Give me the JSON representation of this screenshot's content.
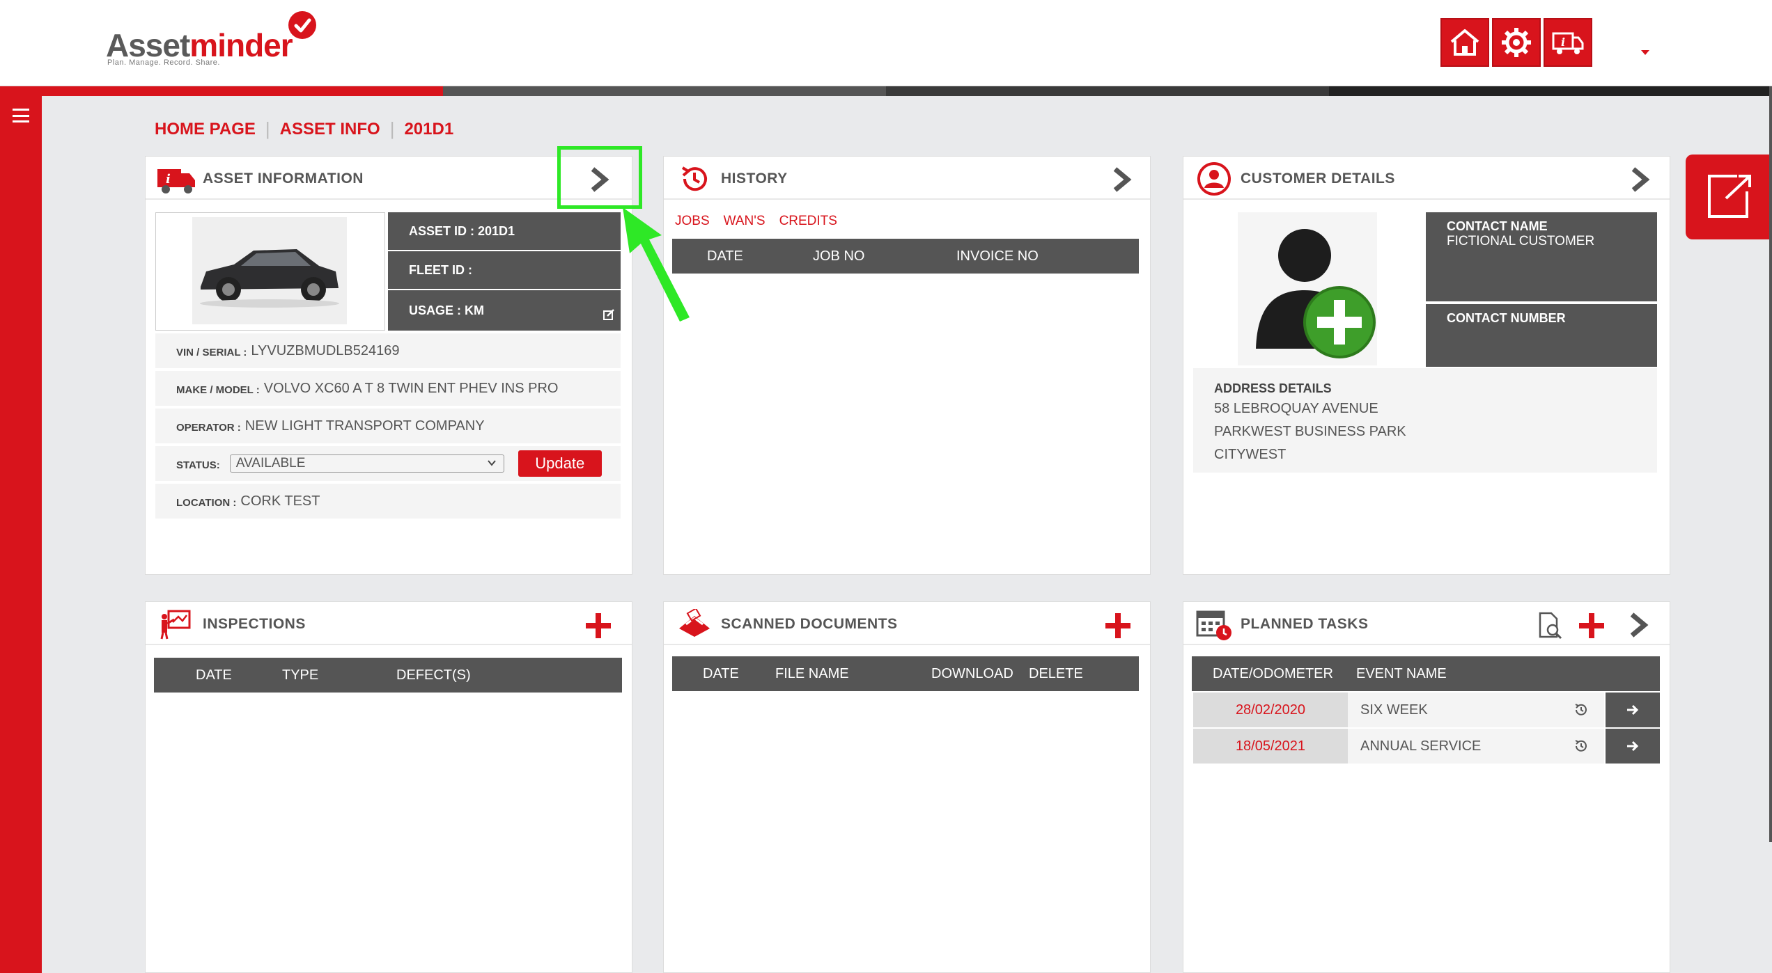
{
  "header": {
    "logo_main": "Asset",
    "logo_accent": "minder",
    "logo_tagline": "Plan. Manage. Record. Share.",
    "icons": [
      "home-icon",
      "settings-gear-icon",
      "info-truck-icon"
    ]
  },
  "colors": {
    "brand_red": "#d8141c",
    "dark_grey": "#555555",
    "light_grey": "#f4f4f4",
    "highlight_green": "#2ee826"
  },
  "breadcrumb": {
    "items": [
      "HOME PAGE",
      "ASSET INFO",
      "201D1"
    ],
    "separator": "|"
  },
  "asset_panel": {
    "title": "ASSET INFORMATION",
    "asset_id": "ASSET ID : 201D1",
    "fleet_id": "FLEET ID :",
    "usage": "USAGE : KM",
    "vin_label": "VIN / SERIAL :",
    "vin_value": "LYVUZBMUDLB524169",
    "make_label": "MAKE / MODEL :",
    "make_value": "VOLVO XC60 A T 8 TWIN ENT PHEV INS PRO",
    "operator_label": "OPERATOR :",
    "operator_value": "NEW LIGHT TRANSPORT COMPANY",
    "status_label": "STATUS:",
    "status_value": "AVAILABLE",
    "update_label": "Update",
    "location_label": "LOCATION :",
    "location_value": "CORK TEST"
  },
  "history_panel": {
    "title": "HISTORY",
    "tabs": [
      "JOBS",
      "WAN'S",
      "CREDITS"
    ],
    "columns": [
      "DATE",
      "JOB NO",
      "INVOICE NO"
    ]
  },
  "customer_panel": {
    "title": "CUSTOMER DETAILS",
    "contact_name_label": "CONTACT NAME",
    "contact_name_value": "FICTIONAL CUSTOMER",
    "contact_number_label": "CONTACT NUMBER",
    "address_label": "ADDRESS DETAILS",
    "address_lines": [
      "58 LEBROQUAY AVENUE",
      "PARKWEST BUSINESS PARK",
      "CITYWEST"
    ]
  },
  "inspections_panel": {
    "title": "INSPECTIONS",
    "columns": [
      "DATE",
      "TYPE",
      "DEFECT(S)"
    ]
  },
  "documents_panel": {
    "title": "SCANNED DOCUMENTS",
    "columns": [
      "DATE",
      "FILE NAME",
      "DOWNLOAD",
      "DELETE"
    ]
  },
  "tasks_panel": {
    "title": "PLANNED TASKS",
    "columns": [
      "DATE/ODOMETER",
      "EVENT NAME"
    ],
    "rows": [
      {
        "date": "28/02/2020",
        "event": "SIX WEEK"
      },
      {
        "date": "18/05/2021",
        "event": "ANNUAL SERVICE"
      }
    ]
  }
}
